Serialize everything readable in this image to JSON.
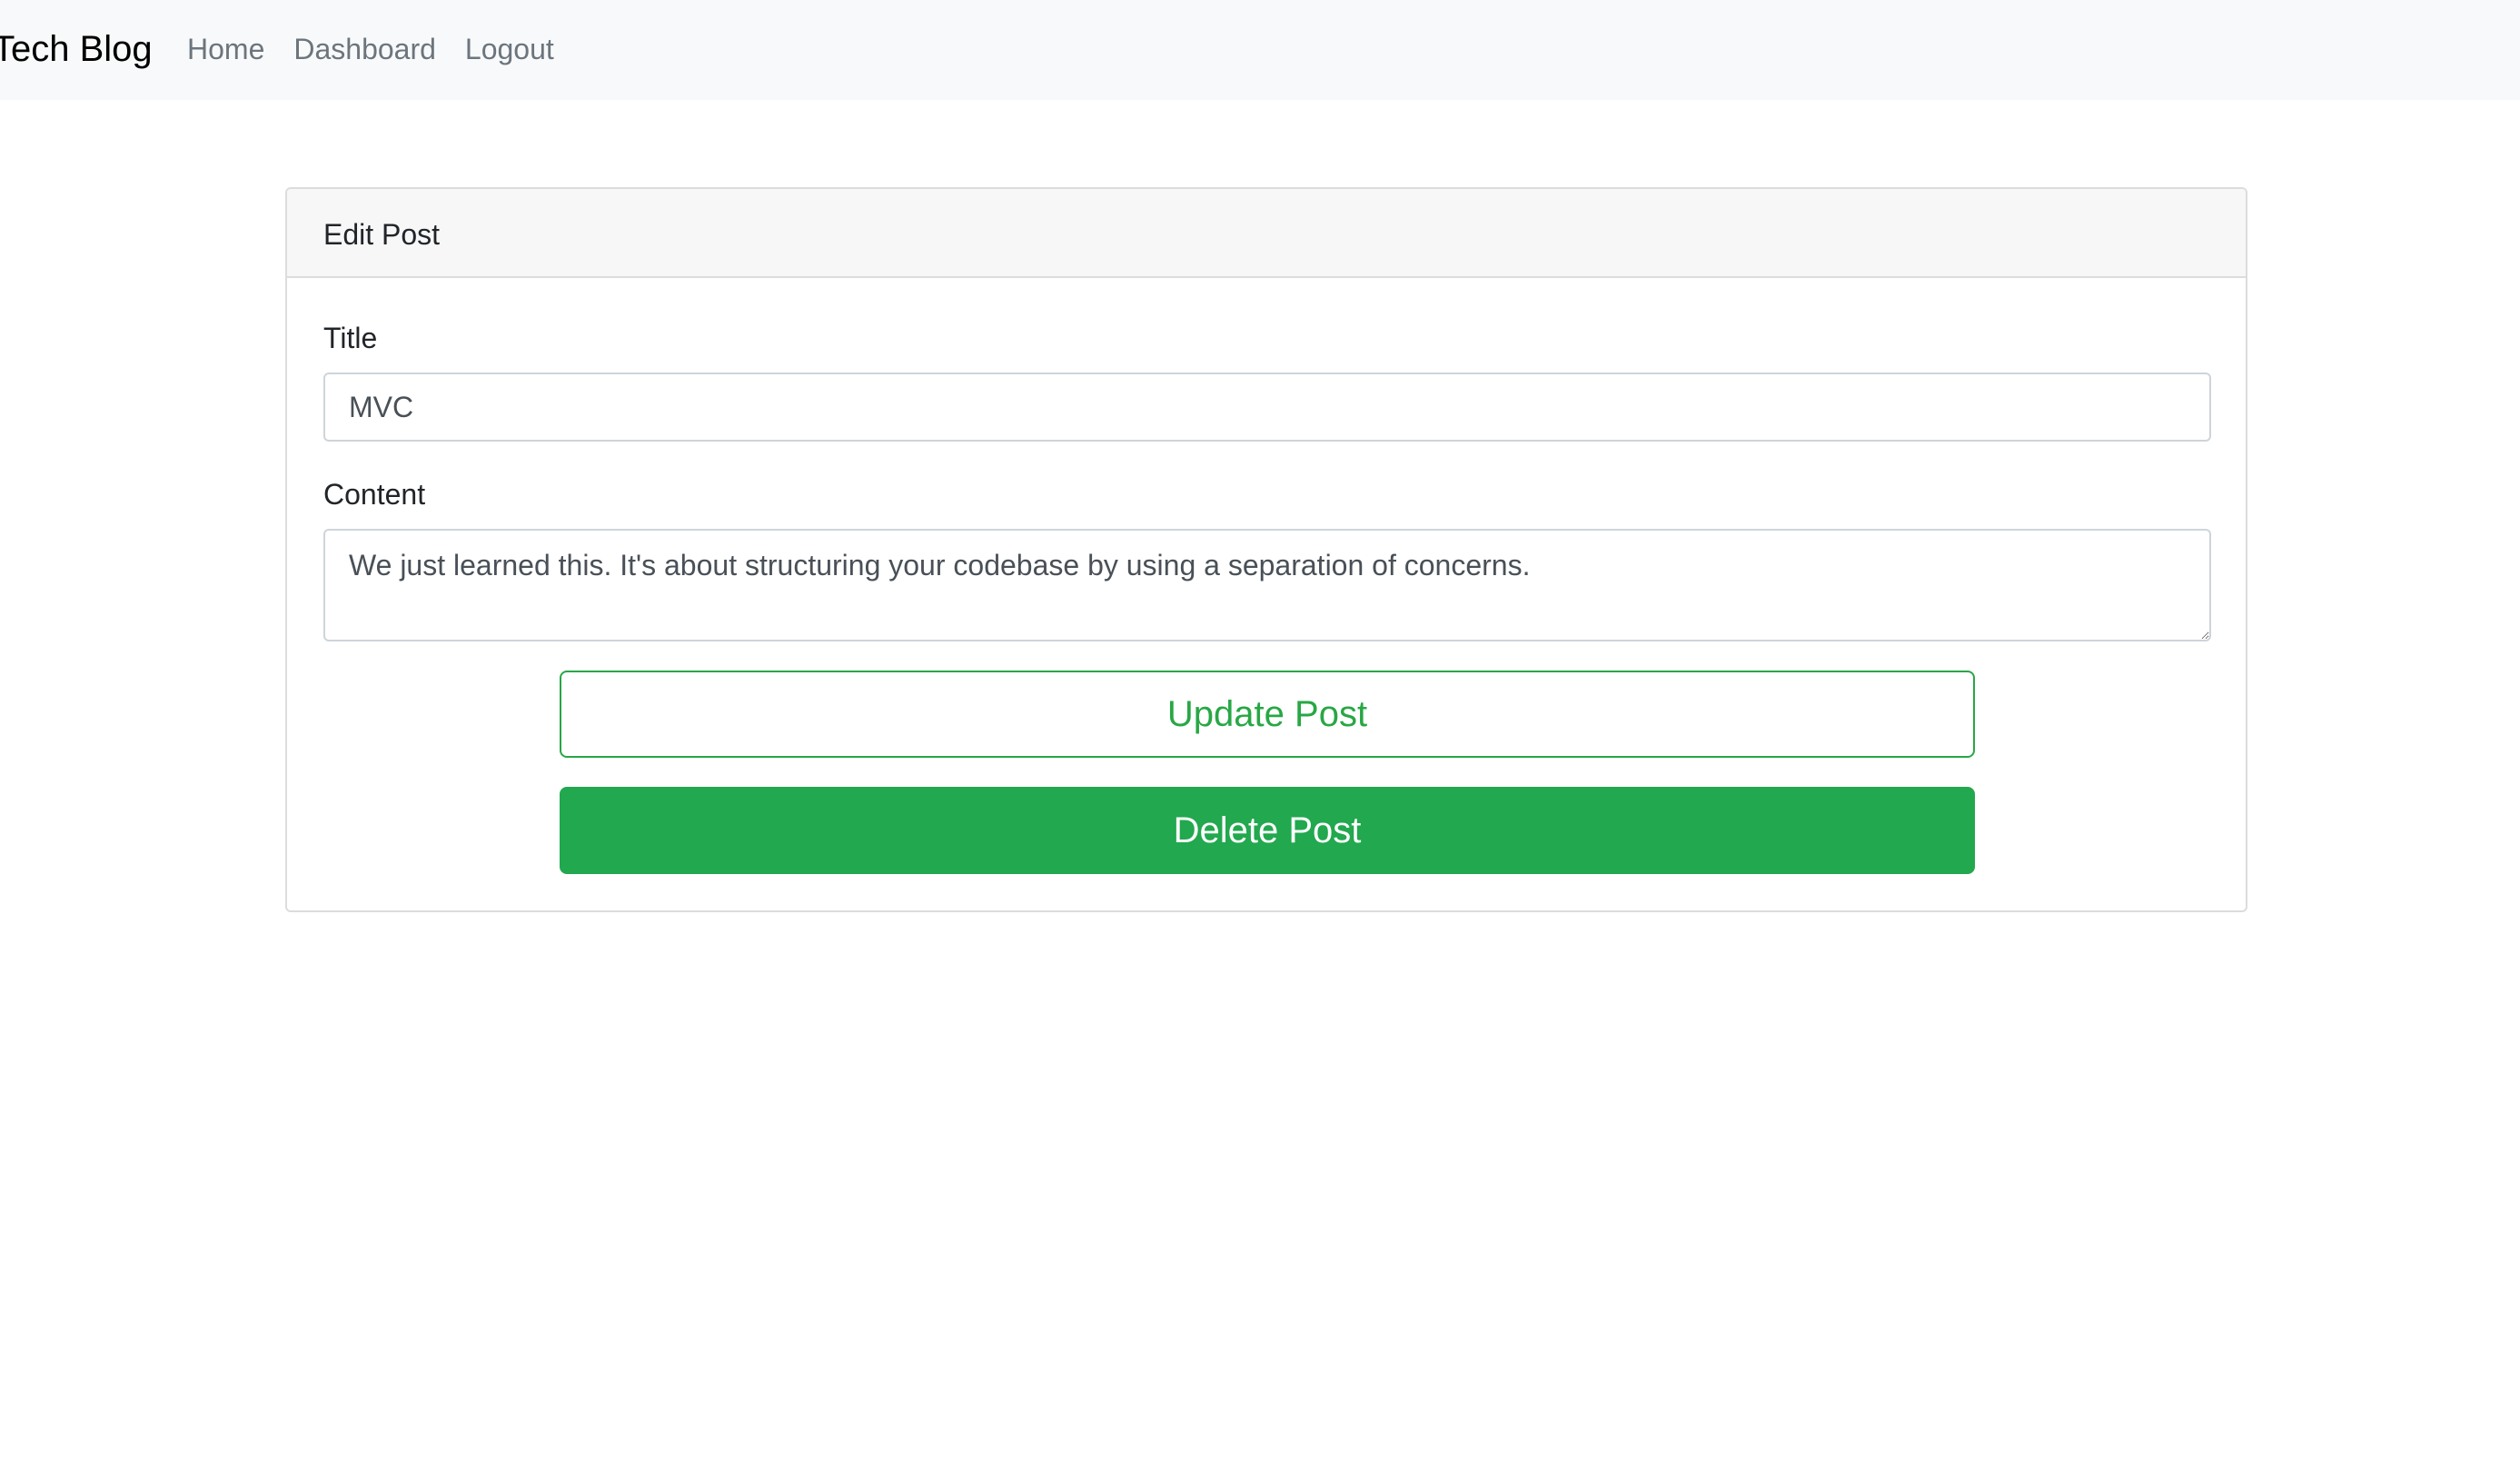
{
  "navbar": {
    "brand": "Tech Blog",
    "links": [
      {
        "label": "Home"
      },
      {
        "label": "Dashboard"
      },
      {
        "label": "Logout"
      }
    ]
  },
  "edit_post": {
    "header": "Edit Post",
    "title_label": "Title",
    "title_value": "MVC",
    "content_label": "Content",
    "content_value": "We just learned this. It's about structuring your codebase by using a separation of concerns.",
    "update_button": "Update Post",
    "delete_button": "Delete Post"
  },
  "colors": {
    "navbar_bg": "#f8f9fa",
    "success": "#28a745",
    "success_fill": "#22a84e",
    "link_muted": "#6c757d"
  }
}
